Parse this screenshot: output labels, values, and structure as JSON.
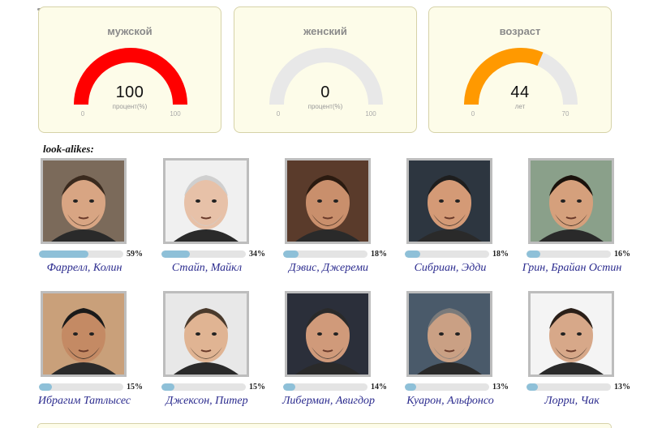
{
  "gauges": [
    {
      "title": "мужской",
      "value": "100",
      "unit": "процент(%)",
      "min": "0",
      "max": "100",
      "fill": 1.0,
      "color": "#ff0000"
    },
    {
      "title": "женский",
      "value": "0",
      "unit": "процент(%)",
      "min": "0",
      "max": "100",
      "fill": 0.0,
      "color": "#ff0000"
    },
    {
      "title": "возраст",
      "value": "44",
      "unit": "лет",
      "min": "0",
      "max": "70",
      "fill": 0.6286,
      "color": "#ff9900"
    }
  ],
  "lookalikes": {
    "title": "look-alikes:",
    "people": [
      {
        "name": "Фаррелл, Колин",
        "percent": "59%",
        "fraction": 0.59
      },
      {
        "name": "Стайп, Майкл",
        "percent": "34%",
        "fraction": 0.34
      },
      {
        "name": "Дэвис, Джереми",
        "percent": "18%",
        "fraction": 0.18
      },
      {
        "name": "Сибриан, Эдди",
        "percent": "18%",
        "fraction": 0.18
      },
      {
        "name": "Грин, Брайан Остин",
        "percent": "16%",
        "fraction": 0.16
      },
      {
        "name": "Ибрагим Татлысес",
        "percent": "15%",
        "fraction": 0.15
      },
      {
        "name": "Джексон, Питер",
        "percent": "15%",
        "fraction": 0.15
      },
      {
        "name": "Либерман, Авигдор",
        "percent": "14%",
        "fraction": 0.14
      },
      {
        "name": "Куарон, Альфонсо",
        "percent": "13%",
        "fraction": 0.13
      },
      {
        "name": "Лорри, Чак",
        "percent": "13%",
        "fraction": 0.13
      }
    ]
  },
  "colors": {
    "track": "#e8e8e8",
    "bar_fill": "#8ec0d8",
    "name_link": "#2b2b8e",
    "card_bg": "#fdfce9"
  }
}
